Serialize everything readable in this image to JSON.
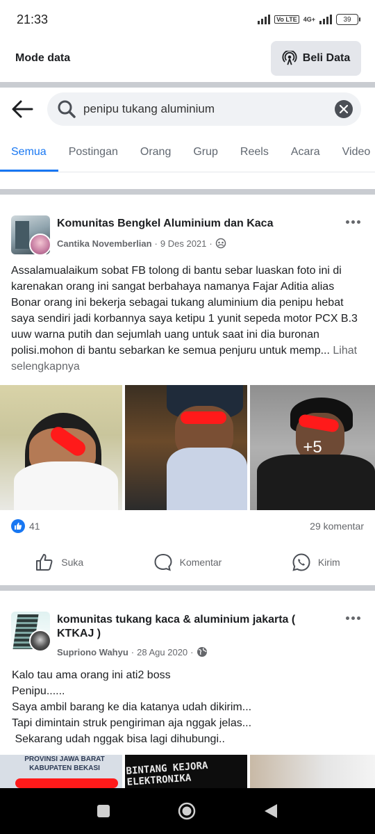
{
  "status_bar": {
    "time": "21:33",
    "volte": "Vo LTE",
    "network": "4G+",
    "battery": "39"
  },
  "mode_bar": {
    "label": "Mode data",
    "button_label": "Beli Data"
  },
  "search": {
    "query": "penipu tukang aluminium"
  },
  "tabs": [
    {
      "label": "Semua",
      "active": true
    },
    {
      "label": "Postingan",
      "active": false
    },
    {
      "label": "Orang",
      "active": false
    },
    {
      "label": "Grup",
      "active": false
    },
    {
      "label": "Reels",
      "active": false
    },
    {
      "label": "Acara",
      "active": false
    },
    {
      "label": "Video",
      "active": false
    }
  ],
  "post1": {
    "group": "Komunitas Bengkel Aluminium dan Kaca",
    "author": "Cantika Novemberlian",
    "date": "9 Des 2021",
    "privacy_icon": "group-icon",
    "text": "Assalamualaikum sobat FB tolong di bantu sebar luaskan foto ini di karenakan orang ini sangat berbahaya namanya Fajar Aditia alias Bonar orang ini bekerja sebagai tukang aluminium dia penipu hebat saya sendiri jadi korbannya saya ketipu 1 yunit sepeda motor PCX B.3   uuw warna putih dan sejumlah uang untuk saat ini dia buronan polisi.mohon di bantu sebarkan ke semua penjuru untuk memp...",
    "see_more": "Lihat selengkapnya",
    "more_photos": "+5",
    "like_count": "41",
    "comments": "29 komentar"
  },
  "actions": {
    "like": "Suka",
    "comment": "Komentar",
    "send": "Kirim"
  },
  "post2": {
    "group": "komunitas tukang kaca & aluminium jakarta ( KTKAJ )",
    "author": "Supriono Wahyu",
    "date": "28 Agu 2020",
    "privacy_icon": "globe-icon",
    "lines": [
      "Kalo tau ama orang ini ati2 boss",
      "Penipu......",
      "Saya ambil barang ke dia katanya udah dikirim...",
      "Tapi dimintain struk pengiriman aja nggak jelas...",
      " Sekarang udah nggak bisa lagi dihubungi.."
    ],
    "photo1_caption": "PROVINSI JAWA BARAT KABUPATEN BEKASI",
    "photo2_caption": "BINTANG KEJORA ELEKTRONIKA"
  },
  "colors": {
    "accent": "#1877f2",
    "divider": "#c9ccd1",
    "redaction": "#ff1a1a"
  }
}
